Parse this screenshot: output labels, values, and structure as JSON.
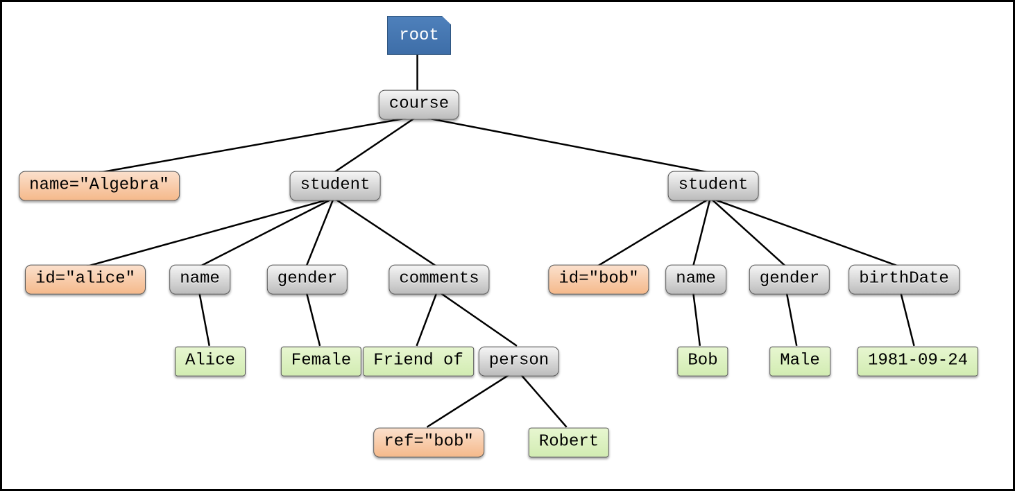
{
  "root": {
    "label": "root"
  },
  "course": {
    "label": "course",
    "attr_name": "name=\"Algebra\""
  },
  "student1": {
    "label": "student",
    "attr_id": "id=\"alice\"",
    "name": {
      "label": "name",
      "value": "Alice"
    },
    "gender": {
      "label": "gender",
      "value": "Female"
    },
    "comments": {
      "label": "comments",
      "text": "Friend of",
      "person": {
        "label": "person",
        "attr_ref": "ref=\"bob\"",
        "value": "Robert"
      }
    }
  },
  "student2": {
    "label": "student",
    "attr_id": "id=\"bob\"",
    "name": {
      "label": "name",
      "value": "Bob"
    },
    "gender": {
      "label": "gender",
      "value": "Male"
    },
    "birthDate": {
      "label": "birthDate",
      "value": "1981-09-24"
    }
  }
}
